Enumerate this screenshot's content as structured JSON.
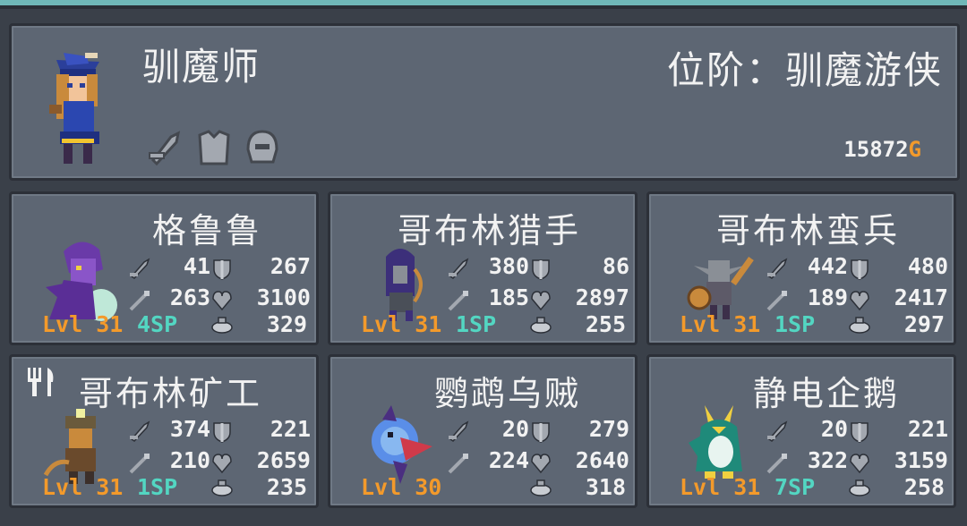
{
  "hero": {
    "name": "驯魔师",
    "rank": "位阶：驯魔游侠",
    "gold_amount": "15872",
    "gold_symbol": "G",
    "equipment_icons": [
      "weapon-slot-icon",
      "armor-slot-icon",
      "helmet-slot-icon"
    ]
  },
  "monsters": [
    {
      "name": "格鲁鲁",
      "attack": "41",
      "defense": "267",
      "magic": "263",
      "health": "3100",
      "level": "Lvl 31",
      "sp": "4SP",
      "food": "329"
    },
    {
      "name": "哥布林猎手",
      "attack": "380",
      "defense": "86",
      "magic": "185",
      "health": "2897",
      "level": "Lvl 31",
      "sp": "1SP",
      "food": "255"
    },
    {
      "name": "哥布林蛮兵",
      "attack": "442",
      "defense": "480",
      "magic": "189",
      "health": "2417",
      "level": "Lvl 31",
      "sp": "1SP",
      "food": "297"
    },
    {
      "name": "哥布林矿工",
      "attack": "374",
      "defense": "221",
      "magic": "210",
      "health": "2659",
      "level": "Lvl 31",
      "sp": "1SP",
      "food": "235"
    },
    {
      "name": "鹦鹉乌贼",
      "attack": "20",
      "defense": "279",
      "magic": "224",
      "health": "2640",
      "level": "Lvl 30",
      "sp": "",
      "food": "318"
    },
    {
      "name": "静电企鹅",
      "attack": "20",
      "defense": "221",
      "magic": "322",
      "health": "3159",
      "level": "Lvl 31",
      "sp": "7SP",
      "food": "258"
    }
  ],
  "colors": {
    "level": "#f39a2b",
    "sp": "#53d6c2",
    "gold": "#f39a2b",
    "panel": "#5d6673"
  }
}
